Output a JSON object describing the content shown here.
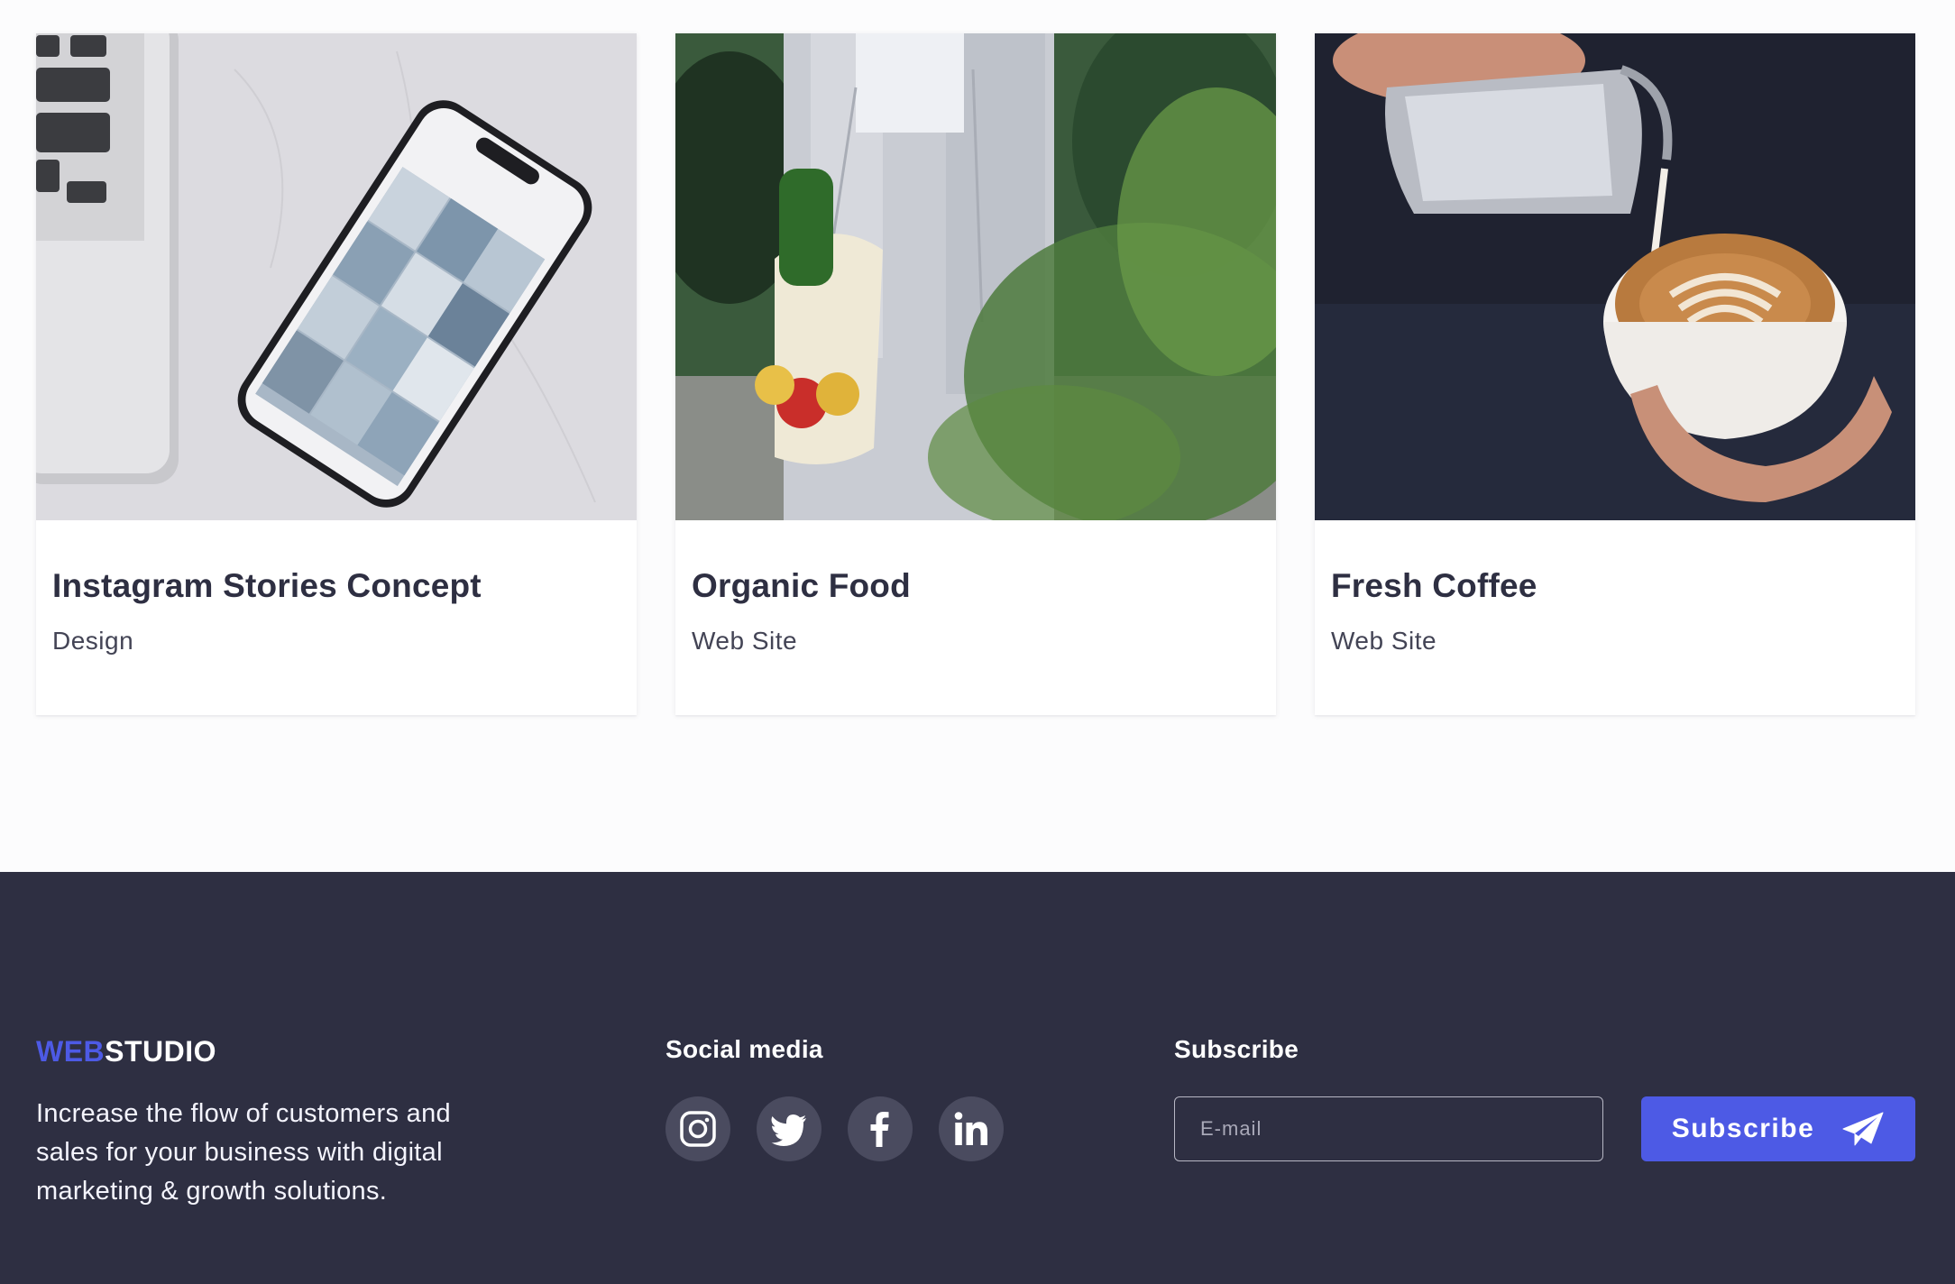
{
  "portfolio": {
    "items": [
      {
        "title": "Instagram Stories Concept",
        "category": "Design"
      },
      {
        "title": "Organic Food",
        "category": "Web Site"
      },
      {
        "title": "Fresh Coffee",
        "category": "Web Site"
      }
    ]
  },
  "footer": {
    "logo": {
      "part1": "WEB",
      "part2": "STUDIO"
    },
    "tagline": "Increase the flow of customers and sales for your business with digital marketing & growth solutions.",
    "social": {
      "heading": "Social media",
      "icons": [
        "instagram-icon",
        "twitter-icon",
        "facebook-icon",
        "linkedin-icon"
      ]
    },
    "subscribe": {
      "heading": "Subscribe",
      "email_placeholder": "E-mail",
      "email_value": "",
      "button_label": "Subscribe",
      "button_icon": "send-icon"
    }
  },
  "colors": {
    "accent": "#4d5ae5",
    "footer_bg": "#2e2f42",
    "text_dark": "#2e2f42",
    "text_muted": "#434455",
    "social_bg": "#4a4b5f"
  }
}
